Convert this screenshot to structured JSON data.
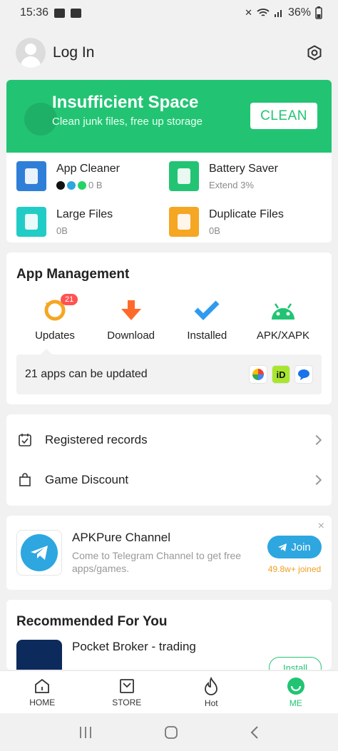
{
  "status_bar": {
    "time": "15:36",
    "battery": "36%"
  },
  "header": {
    "login_label": "Log In",
    "settings_icon": "gear-icon"
  },
  "cleaner_banner": {
    "title": "Insufficient Space",
    "subtitle": "Clean junk files, free up storage",
    "button": "CLEAN",
    "color": "#22c473"
  },
  "tools": [
    {
      "name": "App Cleaner",
      "sub": "0 B",
      "icon": "trash-icon",
      "color": "#2f7fd8"
    },
    {
      "name": "Battery Saver",
      "sub": "Extend 3%",
      "icon": "battery-icon",
      "color": "#22c473"
    },
    {
      "name": "Large Files",
      "sub": "0B",
      "icon": "file-icon",
      "color": "#22ccc6"
    },
    {
      "name": "Duplicate Files",
      "sub": "0B",
      "icon": "duplicate-file-icon",
      "color": "#f5a623"
    }
  ],
  "app_management": {
    "title": "App Management",
    "items": [
      {
        "label": "Updates",
        "badge": "21"
      },
      {
        "label": "Download"
      },
      {
        "label": "Installed"
      },
      {
        "label": "APK/XAPK"
      }
    ],
    "update_text": "21 apps can be updated"
  },
  "list_items": [
    {
      "label": "Registered records"
    },
    {
      "label": "Game Discount"
    }
  ],
  "channel": {
    "title": "APKPure Channel",
    "desc": "Come to Telegram Channel to get free apps/games.",
    "join": "Join",
    "joined": "49.8w+ joined",
    "close": "×"
  },
  "recommended": {
    "title": "Recommended For You",
    "app_name": "Pocket Broker - trading",
    "install": "Install"
  },
  "bottom_nav": [
    {
      "label": "HOME"
    },
    {
      "label": "STORE"
    },
    {
      "label": "Hot"
    },
    {
      "label": "ME"
    }
  ]
}
